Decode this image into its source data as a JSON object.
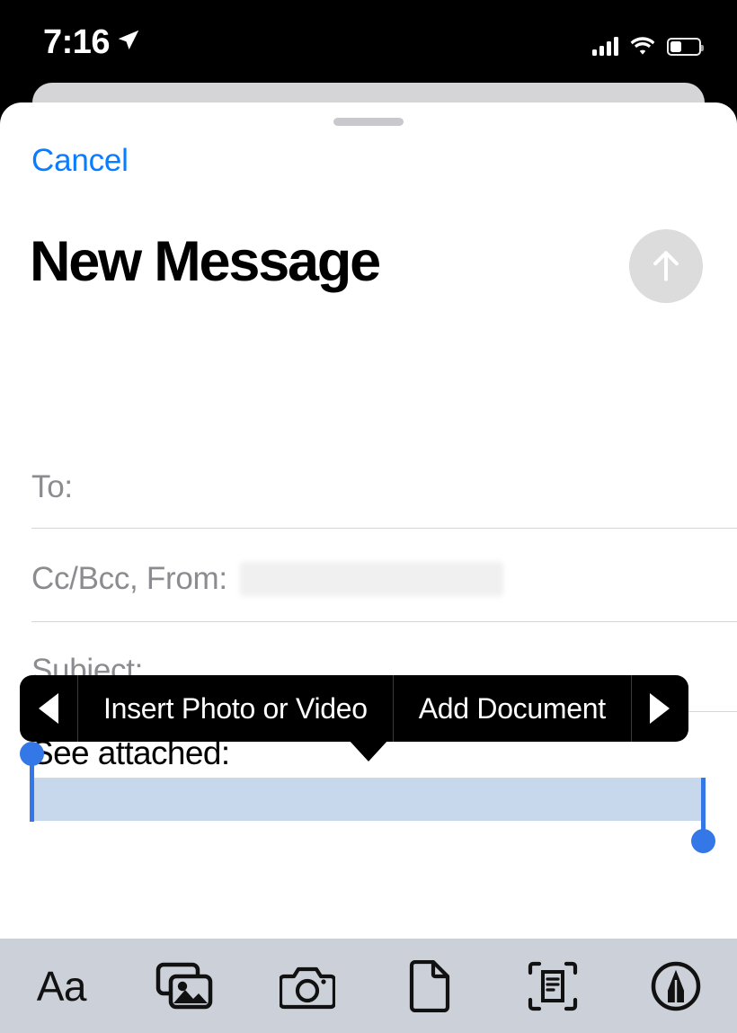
{
  "status_bar": {
    "time": "7:16",
    "location_icon": "location-arrow-icon",
    "signal_icon": "cellular-bars-icon",
    "wifi_icon": "wifi-icon",
    "battery_icon": "battery-icon",
    "battery_fill_percent": 38
  },
  "sheet": {
    "grabber": "sheet-grabber-handle",
    "cancel_label": "Cancel",
    "title": "New Message",
    "send_icon": "arrow-up-icon",
    "send_enabled": false
  },
  "compose_fields": [
    {
      "label": "To:",
      "value": "",
      "redacted": false
    },
    {
      "label": "Cc/Bcc, From:",
      "value": "",
      "redacted": true
    },
    {
      "label": "Subject:",
      "value": "",
      "redacted": false
    }
  ],
  "body": {
    "text": "See attached:",
    "selection_active": true,
    "selection_color": "#c7d8ec",
    "handle_color": "#3478e8"
  },
  "context_menu": {
    "prev_icon": "triangle-left-icon",
    "next_icon": "triangle-right-icon",
    "items": [
      {
        "label": "Insert Photo or Video"
      },
      {
        "label": "Add Document"
      }
    ]
  },
  "toolbar": {
    "items": [
      {
        "icon": "text-format-aa-icon",
        "label": "Aa"
      },
      {
        "icon": "photo-library-icon",
        "label": ""
      },
      {
        "icon": "camera-icon",
        "label": ""
      },
      {
        "icon": "document-icon",
        "label": ""
      },
      {
        "icon": "scan-document-icon",
        "label": ""
      },
      {
        "icon": "markup-pen-icon",
        "label": ""
      }
    ]
  },
  "colors": {
    "accent_blue": "#0a7cff",
    "selection_blue": "#c7d8ec",
    "handle_blue": "#3478e8",
    "toolbar_bg": "#ccd0d8",
    "menu_bg": "#000000",
    "placeholder_grey": "#8c8c90"
  }
}
